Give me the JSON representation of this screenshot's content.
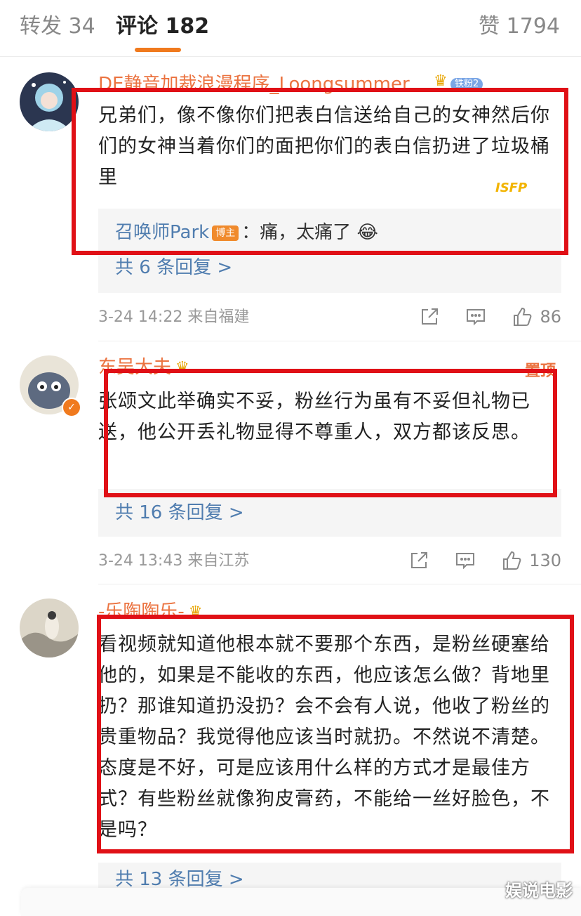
{
  "tabs": {
    "repost": "转发 34",
    "comments": "评论 182",
    "likes": "赞 1794"
  },
  "comments": [
    {
      "user": "DE静音加裁浪漫程序_Loongsummer",
      "fan_badge": "铁粉2",
      "text": "兄弟们，像不像你们把表白信送给自己的女神然后你们的女神当着你们的面把你们的表白信扔进了垃圾桶里",
      "reply_user": "召唤师Park",
      "reply_tag": "博主",
      "reply_text": "：痛，太痛了 😂",
      "more_replies": "共 6 条回复 >",
      "time": "3-24 14:22  来自福建",
      "likes": "86"
    },
    {
      "user": "东吴大夫",
      "top_label": "置顶",
      "text": "张颂文此举确实不妥，粉丝行为虽有不妥但礼物已送，他公开丢礼物显得不尊重人，双方都该反思。",
      "more_replies": "共 16 条回复 >",
      "time": "3-24 13:43  来自江苏",
      "likes": "130"
    },
    {
      "user": "-乐陶陶乐-",
      "text": "看视频就知道他根本就不要那个东西，是粉丝硬塞给他的，如果是不能收的东西，他应该怎么做？背地里扔？那谁知道扔没扔？会不会有人说，他收了粉丝的贵重物品？我觉得他应该当时就扔。不然说不清楚。态度是不好，可是应该用什么样的方式才是最佳方式？有些粉丝就像狗皮膏药，不能给一丝好脸色，不是吗？",
      "more_replies": "共 13 条回复 >"
    }
  ],
  "sticker_text": "ISFP",
  "watermark": "娱说电影",
  "colors": {
    "accent": "#f07a1e",
    "username": "#eb7340",
    "link": "#507daf",
    "highlight_box": "#e01016"
  }
}
